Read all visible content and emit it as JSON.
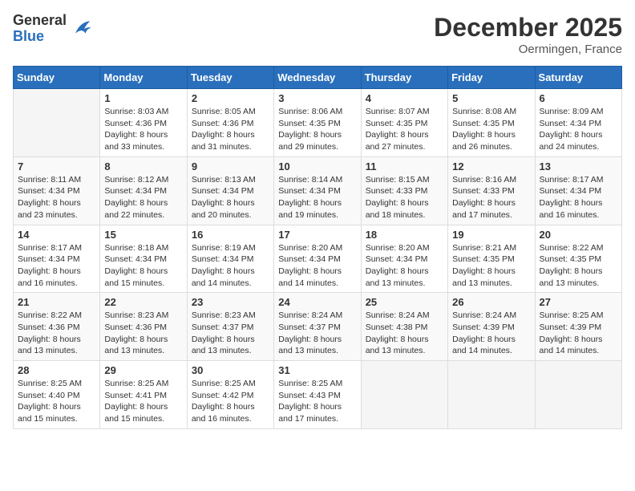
{
  "logo": {
    "general": "General",
    "blue": "Blue"
  },
  "header": {
    "month": "December 2025",
    "location": "Oermingen, France"
  },
  "days_of_week": [
    "Sunday",
    "Monday",
    "Tuesday",
    "Wednesday",
    "Thursday",
    "Friday",
    "Saturday"
  ],
  "weeks": [
    [
      {
        "day": "",
        "sunrise": "",
        "sunset": "",
        "daylight": ""
      },
      {
        "day": "1",
        "sunrise": "Sunrise: 8:03 AM",
        "sunset": "Sunset: 4:36 PM",
        "daylight": "Daylight: 8 hours and 33 minutes."
      },
      {
        "day": "2",
        "sunrise": "Sunrise: 8:05 AM",
        "sunset": "Sunset: 4:36 PM",
        "daylight": "Daylight: 8 hours and 31 minutes."
      },
      {
        "day": "3",
        "sunrise": "Sunrise: 8:06 AM",
        "sunset": "Sunset: 4:35 PM",
        "daylight": "Daylight: 8 hours and 29 minutes."
      },
      {
        "day": "4",
        "sunrise": "Sunrise: 8:07 AM",
        "sunset": "Sunset: 4:35 PM",
        "daylight": "Daylight: 8 hours and 27 minutes."
      },
      {
        "day": "5",
        "sunrise": "Sunrise: 8:08 AM",
        "sunset": "Sunset: 4:35 PM",
        "daylight": "Daylight: 8 hours and 26 minutes."
      },
      {
        "day": "6",
        "sunrise": "Sunrise: 8:09 AM",
        "sunset": "Sunset: 4:34 PM",
        "daylight": "Daylight: 8 hours and 24 minutes."
      }
    ],
    [
      {
        "day": "7",
        "sunrise": "Sunrise: 8:11 AM",
        "sunset": "Sunset: 4:34 PM",
        "daylight": "Daylight: 8 hours and 23 minutes."
      },
      {
        "day": "8",
        "sunrise": "Sunrise: 8:12 AM",
        "sunset": "Sunset: 4:34 PM",
        "daylight": "Daylight: 8 hours and 22 minutes."
      },
      {
        "day": "9",
        "sunrise": "Sunrise: 8:13 AM",
        "sunset": "Sunset: 4:34 PM",
        "daylight": "Daylight: 8 hours and 20 minutes."
      },
      {
        "day": "10",
        "sunrise": "Sunrise: 8:14 AM",
        "sunset": "Sunset: 4:34 PM",
        "daylight": "Daylight: 8 hours and 19 minutes."
      },
      {
        "day": "11",
        "sunrise": "Sunrise: 8:15 AM",
        "sunset": "Sunset: 4:33 PM",
        "daylight": "Daylight: 8 hours and 18 minutes."
      },
      {
        "day": "12",
        "sunrise": "Sunrise: 8:16 AM",
        "sunset": "Sunset: 4:33 PM",
        "daylight": "Daylight: 8 hours and 17 minutes."
      },
      {
        "day": "13",
        "sunrise": "Sunrise: 8:17 AM",
        "sunset": "Sunset: 4:34 PM",
        "daylight": "Daylight: 8 hours and 16 minutes."
      }
    ],
    [
      {
        "day": "14",
        "sunrise": "Sunrise: 8:17 AM",
        "sunset": "Sunset: 4:34 PM",
        "daylight": "Daylight: 8 hours and 16 minutes."
      },
      {
        "day": "15",
        "sunrise": "Sunrise: 8:18 AM",
        "sunset": "Sunset: 4:34 PM",
        "daylight": "Daylight: 8 hours and 15 minutes."
      },
      {
        "day": "16",
        "sunrise": "Sunrise: 8:19 AM",
        "sunset": "Sunset: 4:34 PM",
        "daylight": "Daylight: 8 hours and 14 minutes."
      },
      {
        "day": "17",
        "sunrise": "Sunrise: 8:20 AM",
        "sunset": "Sunset: 4:34 PM",
        "daylight": "Daylight: 8 hours and 14 minutes."
      },
      {
        "day": "18",
        "sunrise": "Sunrise: 8:20 AM",
        "sunset": "Sunset: 4:34 PM",
        "daylight": "Daylight: 8 hours and 13 minutes."
      },
      {
        "day": "19",
        "sunrise": "Sunrise: 8:21 AM",
        "sunset": "Sunset: 4:35 PM",
        "daylight": "Daylight: 8 hours and 13 minutes."
      },
      {
        "day": "20",
        "sunrise": "Sunrise: 8:22 AM",
        "sunset": "Sunset: 4:35 PM",
        "daylight": "Daylight: 8 hours and 13 minutes."
      }
    ],
    [
      {
        "day": "21",
        "sunrise": "Sunrise: 8:22 AM",
        "sunset": "Sunset: 4:36 PM",
        "daylight": "Daylight: 8 hours and 13 minutes."
      },
      {
        "day": "22",
        "sunrise": "Sunrise: 8:23 AM",
        "sunset": "Sunset: 4:36 PM",
        "daylight": "Daylight: 8 hours and 13 minutes."
      },
      {
        "day": "23",
        "sunrise": "Sunrise: 8:23 AM",
        "sunset": "Sunset: 4:37 PM",
        "daylight": "Daylight: 8 hours and 13 minutes."
      },
      {
        "day": "24",
        "sunrise": "Sunrise: 8:24 AM",
        "sunset": "Sunset: 4:37 PM",
        "daylight": "Daylight: 8 hours and 13 minutes."
      },
      {
        "day": "25",
        "sunrise": "Sunrise: 8:24 AM",
        "sunset": "Sunset: 4:38 PM",
        "daylight": "Daylight: 8 hours and 13 minutes."
      },
      {
        "day": "26",
        "sunrise": "Sunrise: 8:24 AM",
        "sunset": "Sunset: 4:39 PM",
        "daylight": "Daylight: 8 hours and 14 minutes."
      },
      {
        "day": "27",
        "sunrise": "Sunrise: 8:25 AM",
        "sunset": "Sunset: 4:39 PM",
        "daylight": "Daylight: 8 hours and 14 minutes."
      }
    ],
    [
      {
        "day": "28",
        "sunrise": "Sunrise: 8:25 AM",
        "sunset": "Sunset: 4:40 PM",
        "daylight": "Daylight: 8 hours and 15 minutes."
      },
      {
        "day": "29",
        "sunrise": "Sunrise: 8:25 AM",
        "sunset": "Sunset: 4:41 PM",
        "daylight": "Daylight: 8 hours and 15 minutes."
      },
      {
        "day": "30",
        "sunrise": "Sunrise: 8:25 AM",
        "sunset": "Sunset: 4:42 PM",
        "daylight": "Daylight: 8 hours and 16 minutes."
      },
      {
        "day": "31",
        "sunrise": "Sunrise: 8:25 AM",
        "sunset": "Sunset: 4:43 PM",
        "daylight": "Daylight: 8 hours and 17 minutes."
      },
      {
        "day": "",
        "sunrise": "",
        "sunset": "",
        "daylight": ""
      },
      {
        "day": "",
        "sunrise": "",
        "sunset": "",
        "daylight": ""
      },
      {
        "day": "",
        "sunrise": "",
        "sunset": "",
        "daylight": ""
      }
    ]
  ]
}
